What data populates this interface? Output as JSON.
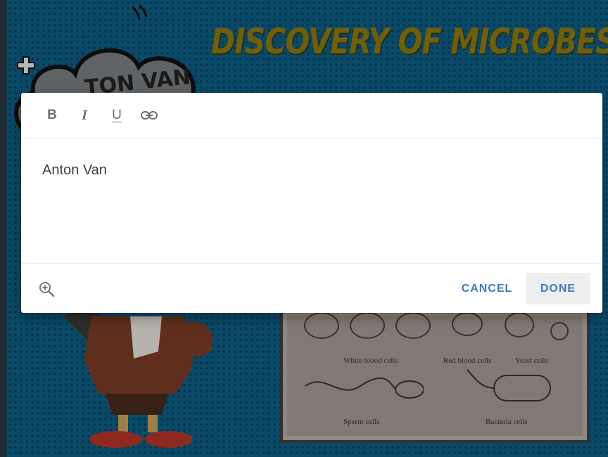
{
  "slide": {
    "title": "DISCOVERY OF MICROBES",
    "cloud_text": "TON VAN",
    "photo_captions": {
      "white": "White blood cells",
      "red": "Red blood cells",
      "yeast": "Yeast cells",
      "sperm": "Sperm cells",
      "bacteria": "Bacteria cells"
    }
  },
  "dialog": {
    "toolbar": {
      "bold": "B",
      "italic": "I",
      "underline": "U",
      "link_icon": "link-icon"
    },
    "editor": {
      "text": "Anton Van"
    },
    "footer": {
      "zoom_icon": "zoom-in-icon",
      "cancel_label": "CANCEL",
      "done_label": "DONE"
    }
  },
  "colors": {
    "background": "#0e5f86",
    "title": "#8c7a12",
    "accent": "#3a7cc1",
    "done_bg": "#eeeeee"
  }
}
